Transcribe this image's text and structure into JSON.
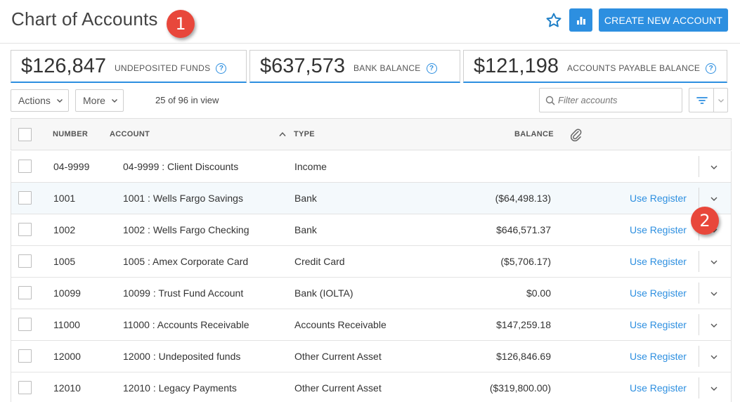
{
  "header": {
    "title": "Chart of Accounts",
    "create_button": "CREATE NEW ACCOUNT",
    "annotation_1": "1",
    "annotation_2": "2"
  },
  "stats": [
    {
      "value": "$126,847",
      "label": "UNDEPOSITED FUNDS",
      "help": "?"
    },
    {
      "value": "$637,573",
      "label": "BANK BALANCE",
      "help": "?"
    },
    {
      "value": "$121,198",
      "label": "ACCOUNTS PAYABLE BALANCE",
      "help": "?"
    }
  ],
  "toolbar": {
    "actions_label": "Actions",
    "more_label": "More",
    "view_count": "25 of 96 in view",
    "filter_placeholder": "Filter accounts"
  },
  "table": {
    "columns": {
      "number": "NUMBER",
      "account": "ACCOUNT",
      "type": "TYPE",
      "balance": "BALANCE"
    },
    "rows": [
      {
        "number": "04-9999",
        "account": "04-9999 : Client Discounts",
        "type": "Income",
        "balance": "",
        "action": ""
      },
      {
        "number": "1001",
        "account": "1001 : Wells Fargo Savings",
        "type": "Bank",
        "balance": "($64,498.13)",
        "action": "Use Register"
      },
      {
        "number": "1002",
        "account": "1002 : Wells Fargo Checking",
        "type": "Bank",
        "balance": "$646,571.37",
        "action": "Use Register"
      },
      {
        "number": "1005",
        "account": "1005 : Amex Corporate Card",
        "type": "Credit Card",
        "balance": "($5,706.17)",
        "action": "Use Register"
      },
      {
        "number": "10099",
        "account": "10099 : Trust Fund Account",
        "type": "Bank (IOLTA)",
        "balance": "$0.00",
        "action": "Use Register"
      },
      {
        "number": "11000",
        "account": "11000 : Accounts Receivable",
        "type": "Accounts Receivable",
        "balance": "$147,259.18",
        "action": "Use Register"
      },
      {
        "number": "12000",
        "account": "12000 : Undeposited funds",
        "type": "Other Current Asset",
        "balance": "$126,846.69",
        "action": "Use Register"
      },
      {
        "number": "12010",
        "account": "12010 : Legacy Payments",
        "type": "Other Current Asset",
        "balance": "($319,800.00)",
        "action": "Use Register"
      }
    ]
  },
  "colors": {
    "accent": "#2d8fe0",
    "annotation": "#e8473b",
    "row_highlight": "#f4f9fc"
  },
  "icons": {
    "favorite": "star-icon",
    "reports": "bar-chart-icon",
    "help": "help-icon",
    "search": "search-icon",
    "filter": "filter-icon",
    "attachment": "paperclip-icon",
    "sort": "sort-asc-icon",
    "expand": "chevron-down-icon"
  }
}
